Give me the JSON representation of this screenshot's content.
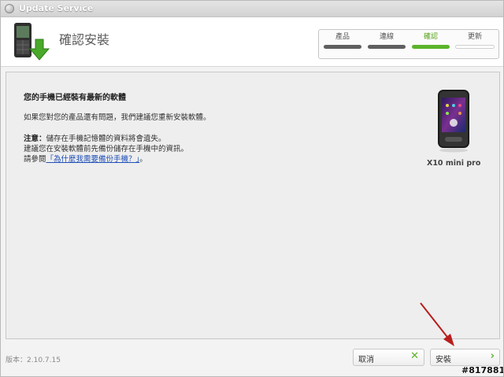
{
  "app": {
    "title": "Update Service"
  },
  "header": {
    "title": "確認安裝"
  },
  "steps": [
    {
      "label": "產品",
      "state": "done"
    },
    {
      "label": "連線",
      "state": "done"
    },
    {
      "label": "確認",
      "state": "active"
    },
    {
      "label": "更新",
      "state": "pending"
    }
  ],
  "content": {
    "headline": "您的手機已經裝有最新的軟體",
    "line1": "如果您對您的產品還有問題，我們建議您重新安裝軟體。",
    "note_label": "注意：",
    "note_text": "儲存在手機記憶體的資料將會遺失。",
    "line3": "建議您在安裝軟體前先備份儲存在手機中的資訊。",
    "line4_prefix": "請參閱",
    "link": "「為什麼我需要備份手機？」",
    "line4_suffix": "。"
  },
  "device": {
    "name": "X10 mini pro"
  },
  "footer": {
    "version": "版本：2.10.7.15",
    "cancel_label": "取消",
    "install_label": "安裝"
  },
  "watermark": "#817881",
  "colors": {
    "accent": "#5cb42a",
    "link": "#2050b8",
    "arrow": "#b81e1e"
  },
  "icons": {
    "cancel": "close-x-icon",
    "install": "chevron-right-icon"
  }
}
